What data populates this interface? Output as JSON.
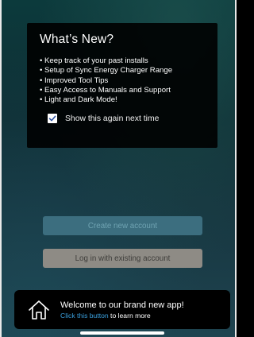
{
  "whats_new": {
    "title": "What’s New?",
    "features": [
      "Keep track of your past installs",
      "Setup of Sync Energy Charger Range",
      "Improved Tool Tips",
      "Easy Access to Manuals and Support",
      "Light and Dark Mode!"
    ],
    "show_again_label": "Show this again next time",
    "show_again_checked": true
  },
  "buttons": {
    "create_account": "Create new account",
    "login": "Log in with existing account"
  },
  "welcome": {
    "title": "Welcome to our brand new app!",
    "link_text": "Click this button",
    "suffix_text": " to learn more",
    "icon": "home-icon"
  },
  "colors": {
    "create_button": "#3c6e7f",
    "login_button": "#8e8b85",
    "link": "#3aa0de",
    "checkbox_check": "#2a4f9e"
  }
}
